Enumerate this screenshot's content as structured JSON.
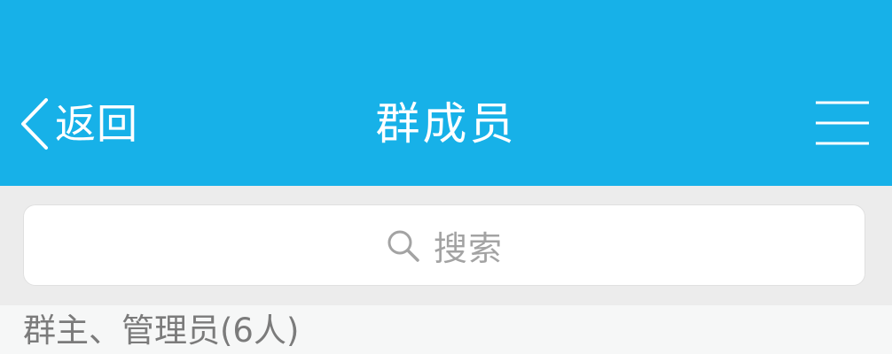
{
  "header": {
    "back_label": "返回",
    "title": "群成员",
    "back_icon": "chevron-left-icon",
    "menu_icon": "hamburger-menu-icon",
    "background_color": "#17b1e8"
  },
  "search": {
    "placeholder": "搜索",
    "icon": "search-icon"
  },
  "sections": [
    {
      "title": "群主、管理员(6人)"
    }
  ]
}
